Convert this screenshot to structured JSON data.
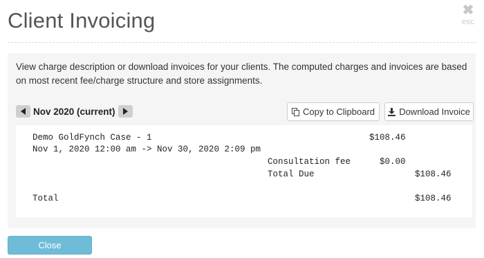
{
  "dialog": {
    "title": "Client Invoicing",
    "close_icon": "x-icon",
    "esc_label": "esc"
  },
  "description": "View charge description or download invoices for your clients. The computed charges and invoices are based on most recent fee/charge structure and store assignments.",
  "period": {
    "label": "Nov 2020 (current)",
    "prev_icon": "chevron-left-icon",
    "next_icon": "chevron-right-icon"
  },
  "actions": {
    "copy_label": "Copy to Clipboard",
    "copy_icon": "copy-icon",
    "download_label": "Download Invoice",
    "download_icon": "download-icon"
  },
  "invoice": {
    "case_name": "Demo GoldFynch Case - 1",
    "case_amount": "$108.46",
    "date_range": "Nov 1, 2020 12:00 am -> Nov 30, 2020 2:09 pm",
    "line_items": [
      {
        "label": "Consultation fee",
        "amount": "$0.00"
      }
    ],
    "total_due_label": "Total Due",
    "total_due_amount": "$108.46",
    "total_label": "Total",
    "total_amount": "$108.46"
  },
  "footer": {
    "close_label": "Close"
  },
  "colors": {
    "primary_button": "#6fbcd9",
    "panel_background": "#f5f5f5"
  }
}
